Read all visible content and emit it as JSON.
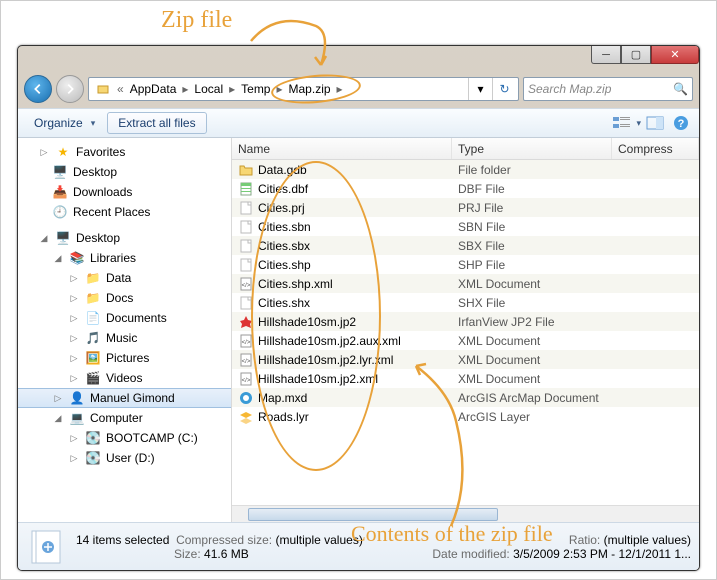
{
  "annotations": {
    "top": "Zip file",
    "bottom": "Contents of the zip file"
  },
  "breadcrumb": [
    "AppData",
    "Local",
    "Temp",
    "Map.zip"
  ],
  "search_placeholder": "Search Map.zip",
  "toolbar": {
    "organize": "Organize",
    "extract": "Extract all files"
  },
  "nav": {
    "favorites": "Favorites",
    "desktop": "Desktop",
    "downloads": "Downloads",
    "recent": "Recent Places",
    "desktop2": "Desktop",
    "libraries": "Libraries",
    "data": "Data",
    "docs": "Docs",
    "documents": "Documents",
    "music": "Music",
    "pictures": "Pictures",
    "videos": "Videos",
    "user": "Manuel Gimond",
    "computer": "Computer",
    "drive_c": "BOOTCAMP (C:)",
    "drive_d": "User (D:)"
  },
  "columns": {
    "name": "Name",
    "type": "Type",
    "compressed": "Compress"
  },
  "files": [
    {
      "name": "Data.gdb",
      "type": "File folder",
      "icon": "folder"
    },
    {
      "name": "Cities.dbf",
      "type": "DBF File",
      "icon": "dbf"
    },
    {
      "name": "Cities.prj",
      "type": "PRJ File",
      "icon": "blank"
    },
    {
      "name": "Cities.sbn",
      "type": "SBN File",
      "icon": "blank"
    },
    {
      "name": "Cities.sbx",
      "type": "SBX File",
      "icon": "blank"
    },
    {
      "name": "Cities.shp",
      "type": "SHP File",
      "icon": "blank"
    },
    {
      "name": "Cities.shp.xml",
      "type": "XML Document",
      "icon": "xml"
    },
    {
      "name": "Cities.shx",
      "type": "SHX File",
      "icon": "blank"
    },
    {
      "name": "Hillshade10sm.jp2",
      "type": "IrfanView JP2 File",
      "icon": "jp2"
    },
    {
      "name": "Hillshade10sm.jp2.aux.xml",
      "type": "XML Document",
      "icon": "xml"
    },
    {
      "name": "Hillshade10sm.jp2.lyr.xml",
      "type": "XML Document",
      "icon": "xml"
    },
    {
      "name": "Hillshade10sm.jp2.xml",
      "type": "XML Document",
      "icon": "xml"
    },
    {
      "name": "Map.mxd",
      "type": "ArcGIS ArcMap Document",
      "icon": "mxd"
    },
    {
      "name": "Roads.lyr",
      "type": "ArcGIS Layer",
      "icon": "lyr"
    }
  ],
  "details": {
    "title": "14 items selected",
    "comp_label": "Compressed size:",
    "comp_val": "(multiple values)",
    "size_label": "Size:",
    "size_val": "41.6 MB",
    "ratio_label": "Ratio:",
    "ratio_val": "(multiple values)",
    "date_label": "Date modified:",
    "date_val": "3/5/2009 2:53 PM - 12/1/2011 1..."
  }
}
